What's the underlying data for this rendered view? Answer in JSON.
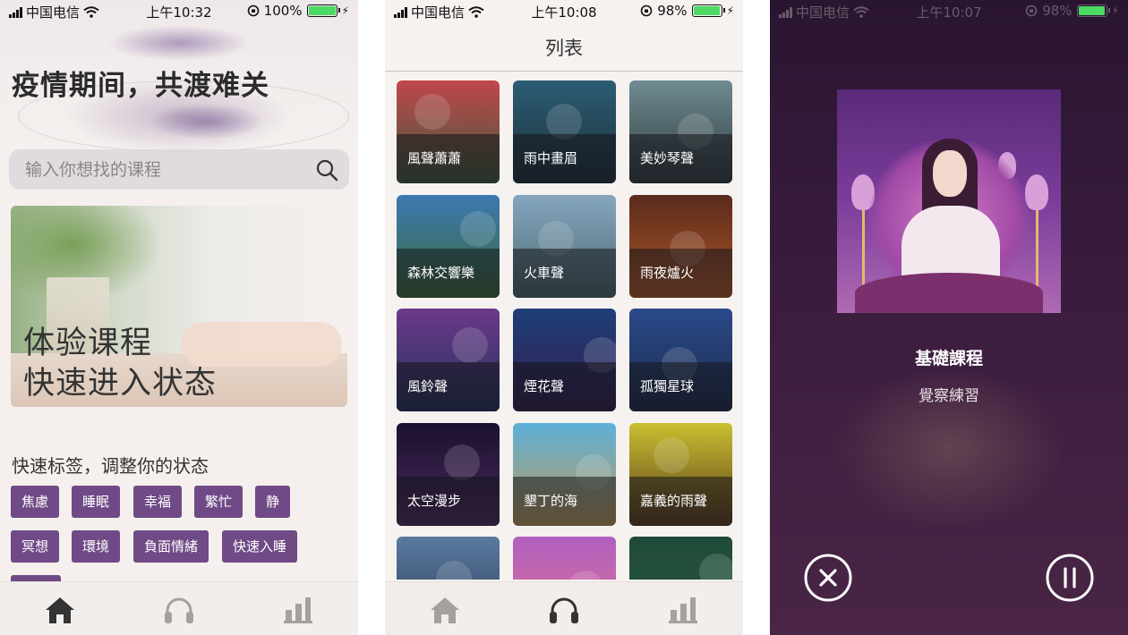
{
  "screen1": {
    "status": {
      "carrier": "中国电信",
      "time": "上午10:32",
      "battery": "100%",
      "battery_level": 1.0
    },
    "title": "疫情期间，共渡难关",
    "search": {
      "placeholder": "输入你想找的课程",
      "icon": "search-icon"
    },
    "banner": {
      "line1": "体验课程",
      "line2": "快速进入状态"
    },
    "section_title": "快速标签，调整你的状态",
    "tags": [
      "焦慮",
      "睡眠",
      "幸福",
      "繁忙",
      "静",
      "冥想",
      "環境",
      "負面情緒",
      "快速入睡"
    ],
    "tabbar": [
      "home-icon",
      "headphones-icon",
      "stats-icon"
    ],
    "colors": {
      "tag": "#6f4a86",
      "active_tab": "#333333",
      "inactive_tab": "#a6a19d"
    }
  },
  "screen2": {
    "status": {
      "carrier": "中国电信",
      "time": "上午10:08",
      "battery": "98%",
      "battery_level": 0.98
    },
    "nav_title": "列表",
    "items": [
      {
        "label": "風聲蕭蕭",
        "colors": [
          "#c0474b",
          "#3f5a3d"
        ]
      },
      {
        "label": "雨中畫眉",
        "colors": [
          "#2c5d74",
          "#1c2f3b"
        ]
      },
      {
        "label": "美妙琴聲",
        "colors": [
          "#6f8b91",
          "#2f3b3e"
        ]
      },
      {
        "label": "森林交響樂",
        "colors": [
          "#3b79b2",
          "#3c6a3a"
        ]
      },
      {
        "label": "火車聲",
        "colors": [
          "#86a6c0",
          "#4d6a70"
        ]
      },
      {
        "label": "雨夜爐火",
        "colors": [
          "#5a2a1c",
          "#b05a2a"
        ]
      },
      {
        "label": "風鈴聲",
        "colors": [
          "#6b3a8a",
          "#22305a"
        ]
      },
      {
        "label": "煙花聲",
        "colors": [
          "#1f3f7a",
          "#321c4a"
        ]
      },
      {
        "label": "孤獨星球",
        "colors": [
          "#2a4a8a",
          "#1c2a4a"
        ]
      },
      {
        "label": "太空漫步",
        "colors": [
          "#1b1030",
          "#4a2a5a"
        ]
      },
      {
        "label": "墾丁的海",
        "colors": [
          "#5db0d8",
          "#c09a5a"
        ]
      },
      {
        "label": "嘉義的雨聲",
        "colors": [
          "#c8c030",
          "#5a3a1c"
        ]
      },
      {
        "label": "",
        "colors": [
          "#5a7aa0",
          "#2a3a55"
        ]
      },
      {
        "label": "",
        "colors": [
          "#b060c0",
          "#e07090"
        ]
      },
      {
        "label": "",
        "colors": [
          "#1f4a3a",
          "#2a5a3a"
        ]
      }
    ],
    "tabbar": [
      "home-icon",
      "headphones-icon",
      "stats-icon"
    ]
  },
  "screen3": {
    "status": {
      "carrier": "中国电信",
      "time": "上午10:07",
      "battery": "98%",
      "battery_level": 0.98
    },
    "course_title": "基礎課程",
    "course_subtitle": "覺察練習",
    "controls": [
      "close-icon",
      "pause-icon"
    ]
  }
}
